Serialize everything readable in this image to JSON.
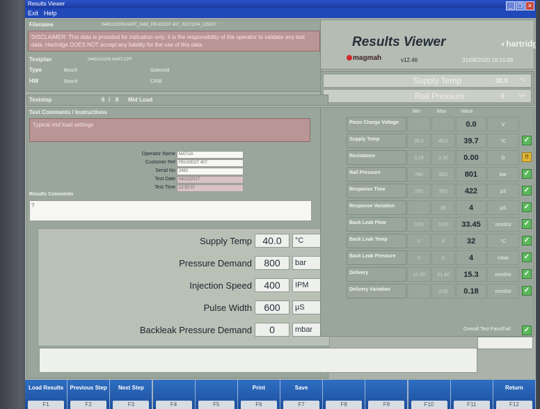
{
  "window": {
    "title_text": "Results Viewer",
    "menu": [
      "Exit",
      "Help"
    ]
  },
  "header": {
    "filename_label": "Filename",
    "filename_value": "0445110209.HART_2482_PEUGEOT 407_20171204_125037",
    "disclaimer": "DISCLAIMER: This data is provided for indication only; it is the responsibility of the operator to validate any test data. Hartridge DOES NOT accept any liability for the use of this data.",
    "app_title": "Results Viewer",
    "version": "v12.46",
    "datetime": "31/08/2020 18:15:08",
    "brand_left": "magmah",
    "brand_right": "hartridge"
  },
  "testplan": {
    "label": "Testplan",
    "value": "0445110209.HART.CPF",
    "type_label": "Type",
    "type_make": "Bosch",
    "type_kind": "Solenoid",
    "hw_label": "HW",
    "hw_make": "Bosch",
    "hw_kind": "CRIB"
  },
  "supply": {
    "supply_temp_label": "Supply Temp",
    "supply_temp_value": "30.0",
    "supply_temp_unit": "°C",
    "rail_label": "Rail Pressure",
    "rail_value": "0",
    "rail_unit": "bar"
  },
  "teststep": {
    "label": "Teststep",
    "current": "6",
    "sep": "/",
    "total": "8",
    "name": "Mid Load"
  },
  "comments": {
    "label": "Test Comments / Instructions",
    "text": "Typical mid load settings"
  },
  "form": {
    "operator_label": "Operator Name",
    "operator": "MATIJA",
    "customer_label": "Customer Ref",
    "customer": "PEUGEOT 407",
    "serial_label": "Serial No",
    "serial": "2482",
    "date_label": "Test Date",
    "date": "04/12/2017",
    "time_label": "Test Time",
    "time": "12:50:37"
  },
  "results_comments": {
    "label": "Results Comments",
    "text": "?"
  },
  "params": [
    {
      "name": "Supply Temp",
      "value": "40.0",
      "unit": "°C"
    },
    {
      "name": "Pressure Demand",
      "value": "800",
      "unit": "bar"
    },
    {
      "name": "Injection Speed",
      "value": "400",
      "unit": "IPM"
    },
    {
      "name": "Pulse Width",
      "value": "600",
      "unit": "µS"
    },
    {
      "name": "Backleak Pressure Demand",
      "value": "0",
      "unit": "mbar"
    }
  ],
  "results_header": {
    "min": "Min",
    "max": "Max",
    "value": "Value"
  },
  "results": [
    {
      "name": "Piezo Charge Voltage",
      "min": "-",
      "max": "-",
      "value": "0.0",
      "unit": "V",
      "status": ""
    },
    {
      "name": "Supply Temp",
      "min": "35.0",
      "max": "45.0",
      "value": "39.7",
      "unit": "°C",
      "status": "pass"
    },
    {
      "name": "Resistance",
      "min": "0.29",
      "max": "0.30",
      "value": "0.00",
      "unit": "Ω",
      "status": "warn"
    },
    {
      "name": "Rail Pressure",
      "min": "780",
      "max": "820",
      "value": "801",
      "unit": "bar",
      "status": "pass"
    },
    {
      "name": "Response Time",
      "min": "250",
      "max": "550",
      "value": "422",
      "unit": "µS",
      "status": "pass"
    },
    {
      "name": "Response Variation",
      "min": "-",
      "max": "36",
      "value": "4",
      "unit": "µS",
      "status": "pass"
    },
    {
      "name": "Back Leak Flow",
      "min": "0.00",
      "max": "0.00",
      "value": "33.45",
      "unit": "mm3/st",
      "status": "pass"
    },
    {
      "name": "Back Leak Temp",
      "min": "0",
      "max": "0",
      "value": "32",
      "unit": "°C",
      "status": "pass"
    },
    {
      "name": "Back Leak Pressure",
      "min": "0",
      "max": "0",
      "value": "4",
      "unit": "mbar",
      "status": "pass"
    },
    {
      "name": "Delivery",
      "min": "12.20",
      "max": "21.40",
      "value": "15.3",
      "unit": "mm3/st",
      "status": "pass"
    },
    {
      "name": "Delivery Variation",
      "min": "-",
      "max": "3.00",
      "value": "0.18",
      "unit": "mm3/st",
      "status": "pass"
    }
  ],
  "overall": {
    "label": "Overall Test Pass/Fail"
  },
  "fkeys": [
    {
      "label": "Load Results",
      "fnum": "F1"
    },
    {
      "label": "Previous Step",
      "fnum": "F2"
    },
    {
      "label": "Next Step",
      "fnum": "F3"
    },
    {
      "label": "",
      "fnum": "F4"
    },
    {
      "label": "",
      "fnum": "F5"
    },
    {
      "label": "Print",
      "fnum": "F6"
    },
    {
      "label": "Save",
      "fnum": "F7"
    },
    {
      "label": "",
      "fnum": "F8"
    },
    {
      "label": "",
      "fnum": "F9"
    },
    {
      "label": "",
      "fnum": "F10"
    },
    {
      "label": "",
      "fnum": "F11"
    },
    {
      "label": "Return",
      "fnum": "F12"
    }
  ]
}
